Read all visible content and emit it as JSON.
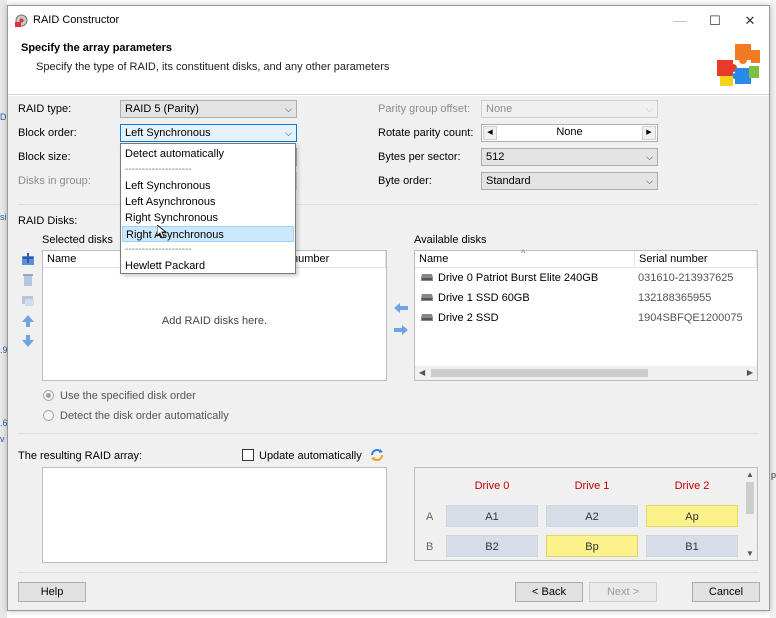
{
  "window": {
    "title": "RAID Constructor"
  },
  "header": {
    "title": "Specify the array parameters",
    "subtitle": "Specify the type of RAID, its constituent disks, and any other parameters"
  },
  "params_left": {
    "raid_type": {
      "label": "RAID type:",
      "value": "RAID 5 (Parity)"
    },
    "block_order": {
      "label": "Block order:",
      "value": "Left Synchronous"
    },
    "block_size": {
      "label": "Block size:"
    },
    "disks_in_group": {
      "label": "Disks in group:"
    }
  },
  "params_right": {
    "parity_group_offset": {
      "label": "Parity group offset:",
      "value": "None"
    },
    "rotate_parity_count": {
      "label": "Rotate parity count:",
      "value": "None"
    },
    "bytes_per_sector": {
      "label": "Bytes per sector:",
      "value": "512"
    },
    "byte_order": {
      "label": "Byte order:",
      "value": "Standard"
    }
  },
  "block_order_dropdown": {
    "items": [
      "Detect automatically",
      "--------------------",
      "Left Synchronous",
      "Left Asynchronous",
      "Right Synchronous",
      "Right Asynchronous",
      "--------------------",
      "Hewlett Packard"
    ],
    "highlighted": "Right Asynchronous"
  },
  "raid_disks": {
    "label": "RAID Disks:",
    "selected_label": "Selected disks",
    "selected_columns": [
      "Name",
      "number"
    ],
    "empty_text": "Add RAID disks here.",
    "available_label": "Available disks",
    "available_columns": [
      "Name",
      "Serial number"
    ],
    "available": [
      {
        "name": "Drive 0 Patriot Burst Elite 240GB",
        "serial": "031610-213937625"
      },
      {
        "name": "Drive 1 SSD 60GB",
        "serial": "132188365955"
      },
      {
        "name": "Drive 2 SSD",
        "serial": "1904SBFQE1200075"
      }
    ]
  },
  "disk_order": {
    "use_specified": "Use the specified disk order",
    "detect_auto": "Detect the disk order automatically"
  },
  "result": {
    "label": "The resulting RAID array:",
    "update_auto": "Update automatically"
  },
  "layout_preview": {
    "drives": [
      "Drive 0",
      "Drive 1",
      "Drive 2"
    ],
    "rows": [
      {
        "label": "A",
        "cells": [
          "A1",
          "A2",
          "Ap"
        ]
      },
      {
        "label": "B",
        "cells": [
          "B2",
          "Bp",
          "B1"
        ]
      }
    ]
  },
  "footer": {
    "help": "Help",
    "back": "< Back",
    "next": "Next >",
    "cancel": "Cancel"
  },
  "colors": {
    "parity": "#fbf28c",
    "data": "#d5dde8",
    "drive_header": "#c00000",
    "accent": "#0078d7"
  },
  "background_fragments": {
    "left": [
      "D",
      "si",
      ".9",
      ".6",
      "v"
    ],
    "right": [
      "p"
    ]
  }
}
